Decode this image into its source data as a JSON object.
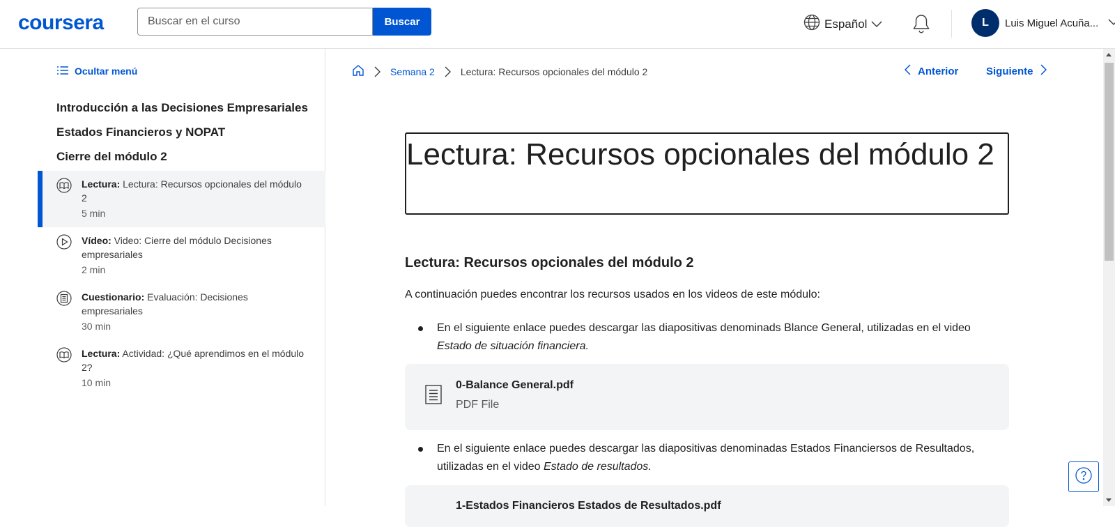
{
  "header": {
    "logo": "coursera",
    "search_placeholder": "Buscar en el curso",
    "search_button": "Buscar",
    "language": "Español",
    "user_initial": "L",
    "user_name": "Luis Miguel Acuña..."
  },
  "sidebar": {
    "hide_menu": "Ocultar menú",
    "modules": [
      "Introducción a las Decisiones Empresariales",
      "Estados Financieros y NOPAT",
      "Cierre del módulo 2"
    ],
    "items": [
      {
        "type": "Lectura:",
        "title": "Lectura: Recursos opcionales del módulo 2",
        "duration": "5 min",
        "icon": "book-icon",
        "active": true
      },
      {
        "type": "Vídeo:",
        "title": "Video: Cierre del módulo Decisiones empresariales",
        "duration": "2 min",
        "icon": "play-icon",
        "active": false
      },
      {
        "type": "Cuestionario:",
        "title": "Evaluación: Decisiones empresariales",
        "duration": "30 min",
        "icon": "quiz-icon",
        "active": false
      },
      {
        "type": "Lectura:",
        "title": "Actividad: ¿Qué aprendimos en el módulo 2?",
        "duration": "10 min",
        "icon": "book-icon",
        "active": false
      }
    ]
  },
  "breadcrumb": {
    "week": "Semana 2",
    "current": "Lectura: Recursos opcionales del módulo 2"
  },
  "nav": {
    "previous": "Anterior",
    "next": "Siguiente"
  },
  "content": {
    "page_title": "Lectura: Recursos opcionales del módulo 2",
    "subtitle": "Lectura: Recursos opcionales del módulo 2",
    "intro": "A continuación puedes encontrar los recursos usados en los videos de este módulo:",
    "bullet1_text": "En el siguiente enlace puedes descargar las diapositivas denominads Blance General, utilizadas en el video ",
    "bullet1_italic": "Estado de situación financiera.",
    "file1_name": "0-Balance General.pdf",
    "file1_type": "PDF File",
    "bullet2_text": "En el siguiente enlace puedes descargar las diapositivas denominadas Estados Financiersos de Resultados, utilizadas en el video ",
    "bullet2_italic": "Estado de resultados.",
    "file2_name": "1-Estados Financieros Estados de Resultados.pdf"
  },
  "colors": {
    "brand": "#0056d2",
    "active_bg": "#f3f4f6",
    "card_bg": "#f3f4f6"
  }
}
